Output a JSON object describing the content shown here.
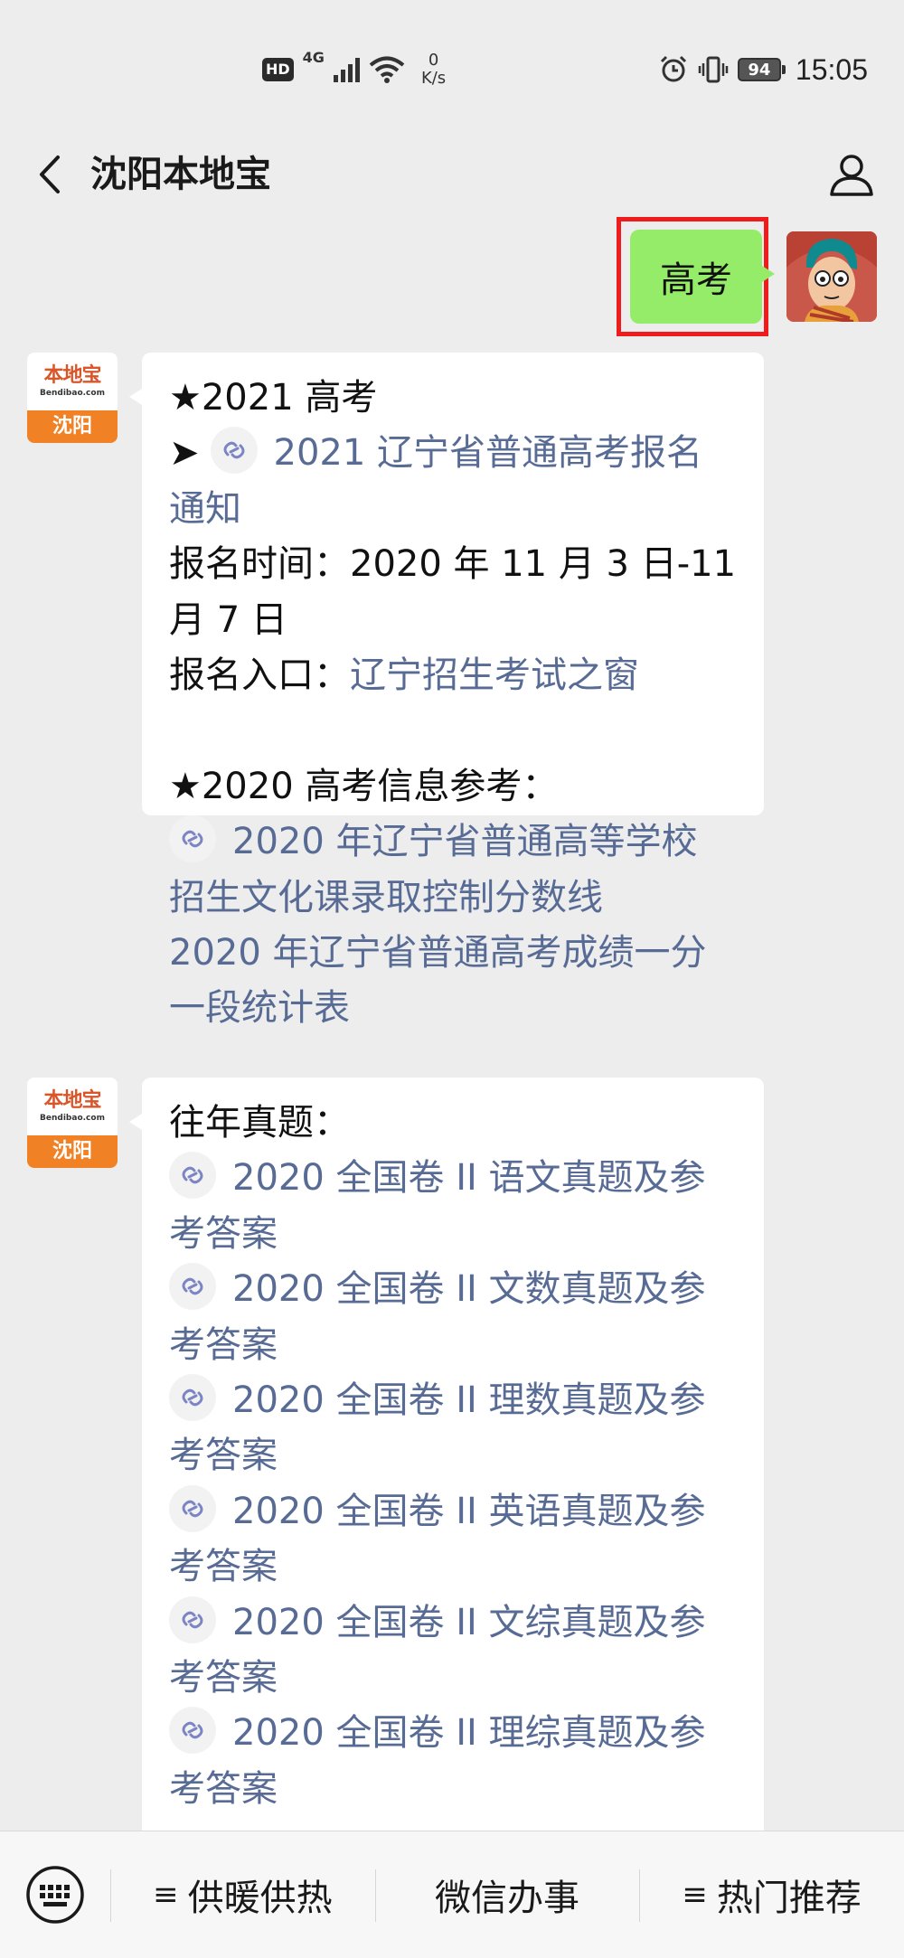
{
  "status_bar": {
    "hd": "HD",
    "network": "4G",
    "speed_value": "0",
    "speed_unit": "K/s",
    "battery": "94",
    "time": "15:05"
  },
  "header": {
    "title": "沈阳本地宝"
  },
  "messages": {
    "user_message": "高考",
    "bot_logo_cn": "本地宝",
    "bot_logo_en": "Bendibao.com",
    "bot_logo_city": "沈阳",
    "reply1": {
      "heading": "★2021 高考",
      "arrow": "➤",
      "link1_line1": "2021 辽宁省普通高考报名",
      "link1_line2": "通知",
      "reg_time_line1": "报名时间：2020 年 11 月 3 日-11",
      "reg_time_line2": "月 7 日",
      "entry_label": "报名入口：",
      "entry_link": "辽宁招生考试之窗",
      "ref_heading": "★2020 高考信息参考：",
      "link2_line1": "2020 年辽宁省普通高等学校",
      "link2_line2": "招生文化课录取控制分数线",
      "link3_line1": "2020 年辽宁省普通高考成绩一分",
      "link3_line2": "一段统计表"
    },
    "reply2": {
      "heading": "往年真题：",
      "items": [
        {
          "line1": "2020 全国卷 II 语文真题及参",
          "line2": "考答案"
        },
        {
          "line1": "2020 全国卷 II 文数真题及参",
          "line2": "考答案"
        },
        {
          "line1": "2020 全国卷 II 理数真题及参",
          "line2": "考答案"
        },
        {
          "line1": "2020 全国卷 II 英语真题及参",
          "line2": "考答案"
        },
        {
          "line1": "2020 全国卷 II 文综真题及参",
          "line2": "考答案"
        },
        {
          "line1": "2020 全国卷 II 理综真题及参",
          "line2": "考答案"
        }
      ]
    }
  },
  "bottom_menu": {
    "items": [
      {
        "prefix": "≡",
        "label": "供暖供热"
      },
      {
        "prefix": "",
        "label": "微信办事"
      },
      {
        "prefix": "≡",
        "label": "热门推荐"
      }
    ]
  },
  "colors": {
    "link": "#576b95",
    "user_bubble": "#95ec69",
    "highlight": "#ee1c1c"
  }
}
